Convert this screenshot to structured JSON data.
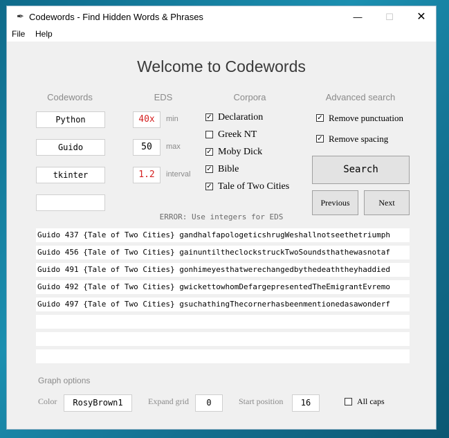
{
  "window": {
    "title": "Codewords - Find Hidden Words & Phrases",
    "icon": "feather-icon",
    "controls": {
      "minimize": "—",
      "maximize": "☐",
      "close": "✕"
    }
  },
  "menu": {
    "items": [
      "File",
      "Help"
    ]
  },
  "heading": "Welcome to Codewords",
  "columns": {
    "codewords": "Codewords",
    "eds": "EDS",
    "corpora": "Corpora",
    "advanced": "Advanced search"
  },
  "codewords": [
    "Python",
    "Guido",
    "tkinter",
    ""
  ],
  "eds": {
    "min": {
      "value": "40x",
      "label": "min"
    },
    "max": {
      "value": "50",
      "label": "max"
    },
    "interval": {
      "value": "1.2",
      "label": "interval"
    },
    "invalid_color": "#d42020"
  },
  "corpora": [
    {
      "label": "Declaration",
      "checked": true
    },
    {
      "label": "Greek NT",
      "checked": false
    },
    {
      "label": "Moby Dick",
      "checked": true
    },
    {
      "label": "Bible",
      "checked": true
    },
    {
      "label": "Tale of Two Cities",
      "checked": true
    }
  ],
  "advanced": {
    "remove_punctuation": {
      "label": "Remove punctuation",
      "checked": true
    },
    "remove_spacing": {
      "label": "Remove spacing",
      "checked": true
    }
  },
  "buttons": {
    "search": "Search",
    "previous": "Previous",
    "next": "Next"
  },
  "error": "ERROR: Use integers for EDS",
  "results": [
    "Guido 437 {Tale of Two Cities} gandhalfapologeticshrugWeshallnotseethetriumph",
    "Guido 456 {Tale of Two Cities} gainuntiltheclockstruckTwoSoundsthathewasnotaf",
    "Guido 491 {Tale of Two Cities} gonhimeyesthatwerechangedbythedeaththeyhaddied",
    "Guido 492 {Tale of Two Cities} gwickettowhomDefargepresentedTheEmigrantEvremo",
    "Guido 497 {Tale of Two Cities} gsuchathingThecornerhasbeenmentionedasawonderf",
    "",
    "",
    ""
  ],
  "graph": {
    "header": "Graph options",
    "color_label": "Color",
    "color_value": "RosyBrown1",
    "expand_label": "Expand grid",
    "expand_value": "0",
    "start_label": "Start position",
    "start_value": "16",
    "allcaps": {
      "label": "All caps",
      "checked": false
    }
  }
}
